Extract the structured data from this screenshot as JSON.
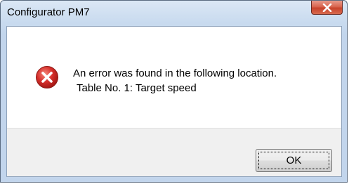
{
  "window": {
    "title": "Configurator PM7",
    "close_icon": "close-icon"
  },
  "dialog": {
    "icon": "error-icon",
    "message_line1": "An error was found in the following location.",
    "message_line2": "Table No. 1: Target speed"
  },
  "buttons": {
    "ok_label": "OK"
  },
  "colors": {
    "error_red": "#d6302c",
    "close_red": "#c8432b"
  }
}
